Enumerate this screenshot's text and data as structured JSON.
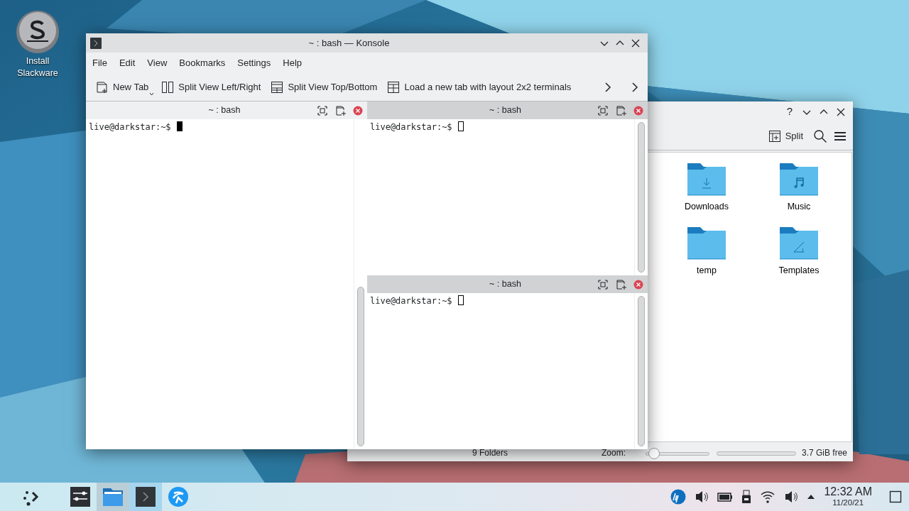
{
  "desktop": {
    "icons": [
      {
        "label": "Install Slackware"
      }
    ]
  },
  "file_manager": {
    "help_button": "?",
    "split_label": "Split",
    "folders": [
      {
        "name": "Downloads",
        "kind": "downloads"
      },
      {
        "name": "Music",
        "kind": "music"
      },
      {
        "name": "temp",
        "kind": "plain"
      },
      {
        "name": "Templates",
        "kind": "templates"
      }
    ],
    "status": {
      "summary": "9 Folders",
      "zoom_label": "Zoom:",
      "zoom": {
        "level": 0.05
      },
      "free_space": "3.7 GiB free"
    }
  },
  "terminal_window": {
    "title": "~ : bash — Konsole",
    "menu": [
      "File",
      "Edit",
      "View",
      "Bookmarks",
      "Settings",
      "Help"
    ],
    "toolbar": [
      {
        "label": "New Tab",
        "kind": "new-tab",
        "has_menu": true
      },
      {
        "label": "Split View Left/Right",
        "kind": "split-lr",
        "has_menu": false
      },
      {
        "label": "Split View Top/Bottom",
        "kind": "split-tb",
        "has_menu": false
      },
      {
        "label": "Load a new tab with layout 2x2 terminals",
        "kind": "layout",
        "has_menu": false
      }
    ],
    "panes": [
      {
        "title": "~ : bash",
        "prompt": "live@darkstar:~$",
        "selected": true
      },
      {
        "title": "~ : bash",
        "prompt": "live@darkstar:~$",
        "selected": false
      },
      {
        "title": "~ : bash",
        "prompt": "live@darkstar:~$",
        "selected": false
      }
    ]
  },
  "taskbar": {
    "tasks": [
      {
        "kind": "launcher",
        "open": false,
        "selected": false
      },
      {
        "kind": "mixer",
        "open": false,
        "selected": false
      },
      {
        "kind": "files",
        "open": true,
        "selected": false
      },
      {
        "kind": "terminal",
        "open": true,
        "selected": true
      },
      {
        "kind": "browser",
        "open": false,
        "selected": false
      }
    ],
    "clock": {
      "time": "12:32 AM",
      "date": "11/20/21"
    }
  }
}
